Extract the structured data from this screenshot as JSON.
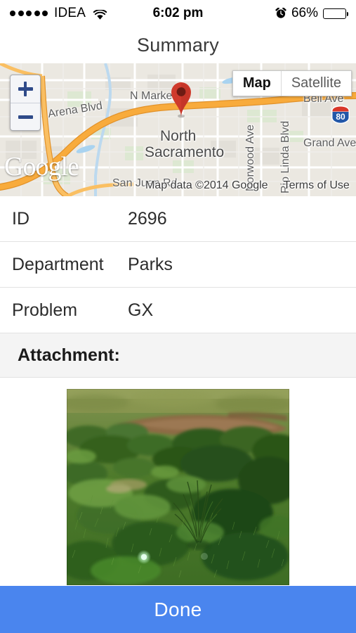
{
  "status_bar": {
    "signal_dots": 5,
    "carrier": "IDEA",
    "wifi_icon": "wifi-icon",
    "time": "6:02 pm",
    "alarm_icon": "alarm-clock-icon",
    "battery_percent": "66%",
    "battery_level": 66
  },
  "nav": {
    "title": "Summary"
  },
  "map": {
    "zoom_in_label": "+",
    "zoom_out_label": "−",
    "map_types": [
      {
        "label": "Map",
        "selected": true
      },
      {
        "label": "Satellite",
        "selected": false
      }
    ],
    "logo": "Google",
    "attribution": "Map data ©2014 Google",
    "terms": "Terms of Use",
    "marker_icon": "map-pin-icon",
    "labels": [
      {
        "text": "Arena Blvd",
        "kind": "street"
      },
      {
        "text": "N Market",
        "kind": "street"
      },
      {
        "text": "Bell Ave",
        "kind": "street"
      },
      {
        "text": "Grand Ave",
        "kind": "street"
      },
      {
        "text": "San Juan Rd",
        "kind": "street"
      },
      {
        "text": "Norwood Ave",
        "kind": "street-vertical"
      },
      {
        "text": "Rio Linda Blvd",
        "kind": "street-vertical"
      },
      {
        "text": "North",
        "kind": "place"
      },
      {
        "text": "Sacramento",
        "kind": "place"
      }
    ],
    "highway_shield": "80",
    "colors": {
      "road": "#f8ab3c",
      "land": "#ebe8e1",
      "water": "#a9d3f0",
      "park": "#d8e7cd",
      "marker": "#e04034"
    }
  },
  "details": {
    "rows": [
      {
        "key": "ID",
        "value": "2696"
      },
      {
        "key": "Department",
        "value": "Parks"
      },
      {
        "key": "Problem",
        "value": "GX"
      }
    ]
  },
  "attachment": {
    "section_title": "Attachment:",
    "photo_alt": "overgrown-grass-and-shrubs-photo"
  },
  "footer": {
    "done_label": "Done",
    "done_color": "#4a85ee"
  }
}
